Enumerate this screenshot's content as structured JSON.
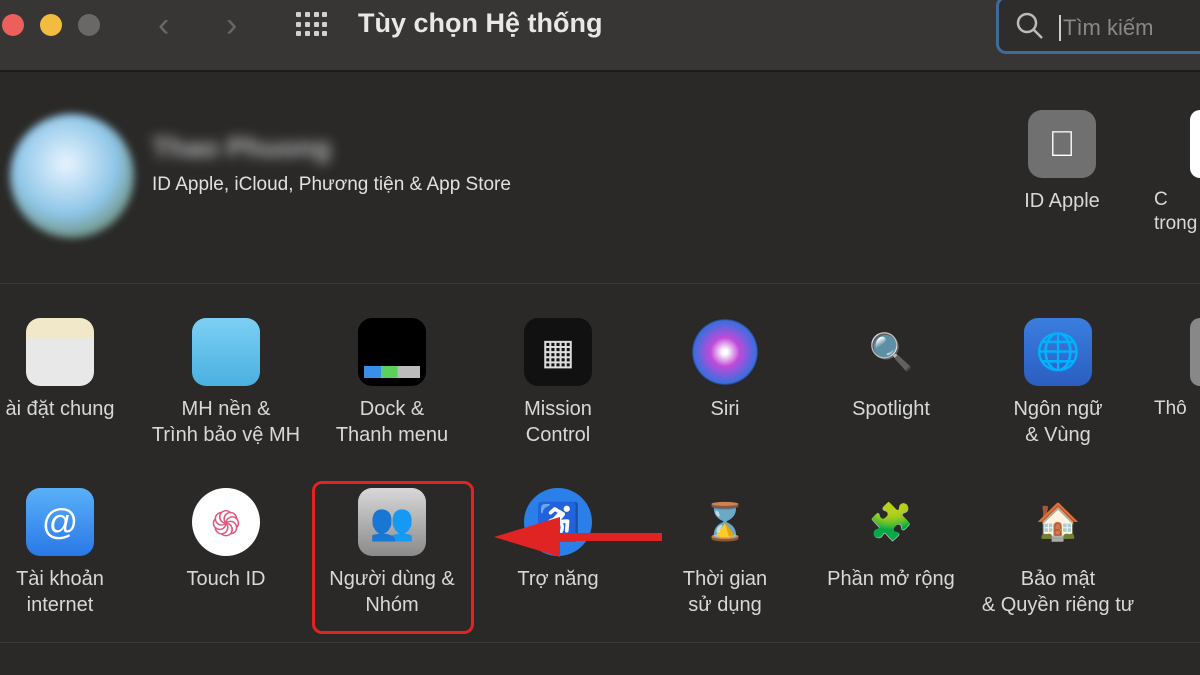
{
  "window": {
    "title": "Tùy chọn Hệ thống",
    "colors": {
      "close": "#ec5f5a",
      "minimize": "#f2bd3e",
      "zoom": "#6a6866"
    }
  },
  "toolbar": {
    "back_icon": "chevron-left",
    "forward_icon": "chevron-right",
    "grid_icon": "grid",
    "search": {
      "placeholder": "Tìm kiếm"
    }
  },
  "profile": {
    "name": "Thao Phuong",
    "subtitle": "ID Apple, iCloud, Phương tiện & App Store",
    "items": [
      {
        "label": "ID Apple",
        "icon": "apple"
      },
      {
        "label": "C\ntrong",
        "icon": "family"
      }
    ]
  },
  "row1": [
    {
      "label": "ài đặt chung",
      "icon": "general"
    },
    {
      "label": "MH nền &\nTrình bảo vệ MH",
      "icon": "desktop"
    },
    {
      "label": "Dock &\nThanh menu",
      "icon": "dock"
    },
    {
      "label": "Mission\nControl",
      "icon": "mission-control"
    },
    {
      "label": "Siri",
      "icon": "siri"
    },
    {
      "label": "Spotlight",
      "icon": "spotlight"
    },
    {
      "label": "Ngôn ngữ\n& Vùng",
      "icon": "globe-flag"
    },
    {
      "label": "Thô",
      "icon": "notifications"
    }
  ],
  "row2": [
    {
      "label": "Tài khoản\ninternet",
      "icon": "at"
    },
    {
      "label": "Touch ID",
      "icon": "fingerprint"
    },
    {
      "label": "Người dùng &\nNhóm",
      "icon": "users",
      "highlighted": true
    },
    {
      "label": "Trợ năng",
      "icon": "accessibility"
    },
    {
      "label": "Thời gian\nsử dụng",
      "icon": "hourglass"
    },
    {
      "label": "Phần mở rộng",
      "icon": "puzzle"
    },
    {
      "label": "Bảo mật\n& Quyền riêng tư",
      "icon": "house-lock"
    }
  ],
  "annotation": {
    "color": "#e02424"
  }
}
